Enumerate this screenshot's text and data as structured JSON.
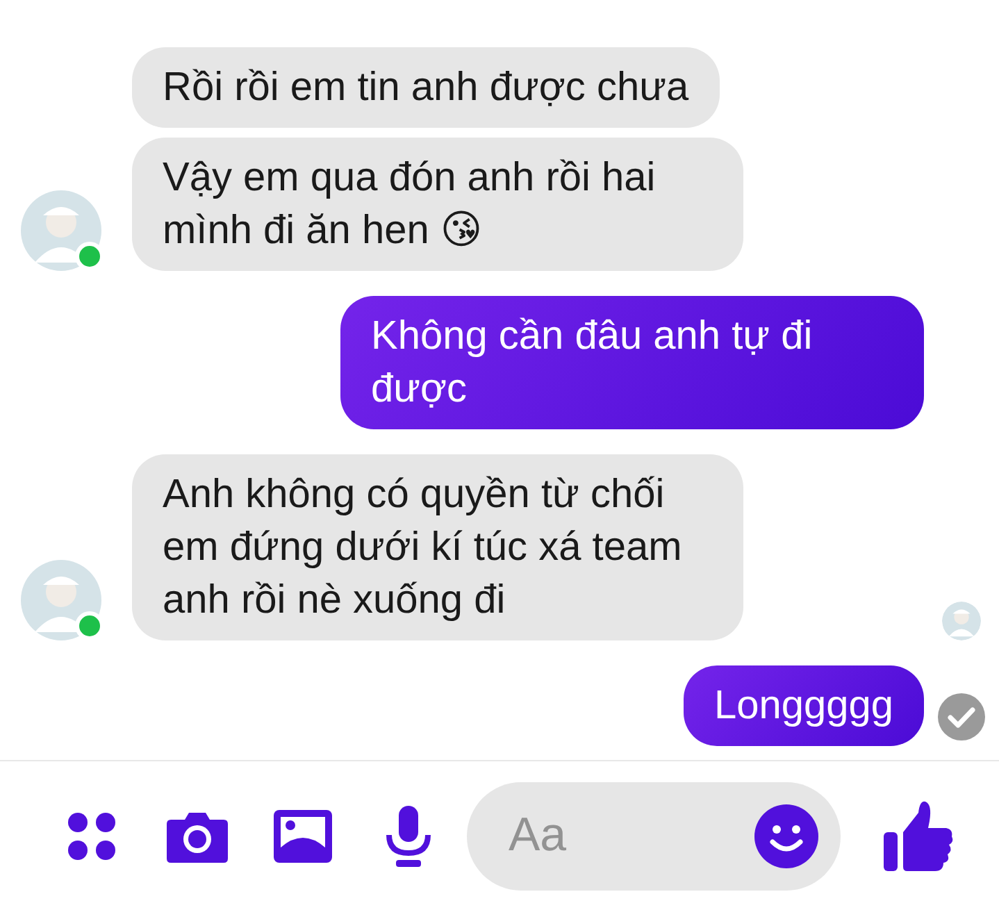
{
  "messages": [
    {
      "kind": "received",
      "text": "Rồi rồi em tin anh được chưa"
    },
    {
      "kind": "received",
      "text": "Vậy em qua đón anh rồi hai mình đi ăn hen 😘",
      "avatar": {
        "online": true
      }
    },
    {
      "kind": "sent",
      "text": "Không cần đâu anh tự đi được"
    },
    {
      "kind": "received",
      "text": "Anh không có quyền từ chối em đứng dưới kí túc xá team anh rồi nè xuống đi",
      "avatar": {
        "online": true
      },
      "seen": true
    },
    {
      "kind": "sent",
      "text": "Longgggg",
      "delivered": true
    }
  ],
  "composer": {
    "placeholder": "Aa"
  }
}
